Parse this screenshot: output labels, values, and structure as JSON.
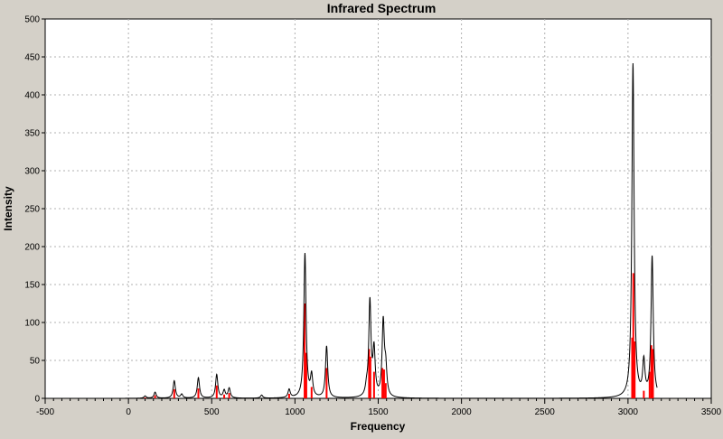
{
  "chart_data": {
    "type": "line",
    "title": "Infrared Spectrum",
    "xlabel": "Frequency",
    "ylabel": "Intensity",
    "xlim": [
      -500,
      3500
    ],
    "ylim": [
      0,
      500
    ],
    "x_ticks": [
      -500,
      0,
      500,
      1000,
      1500,
      2000,
      2500,
      3000,
      3500
    ],
    "y_ticks": [
      0,
      50,
      100,
      150,
      200,
      250,
      300,
      350,
      400,
      450,
      500
    ],
    "grid": true,
    "colors": {
      "background": "#ffffff",
      "frame": "#d4d0c8",
      "spectrum": "#000000",
      "stick": "#ff0000",
      "grid": "#b0b0b0"
    },
    "series": [
      {
        "type": "line",
        "peaks": [
          {
            "x": 100,
            "y": 3
          },
          {
            "x": 160,
            "y": 8
          },
          {
            "x": 275,
            "y": 23
          },
          {
            "x": 320,
            "y": 5
          },
          {
            "x": 420,
            "y": 27
          },
          {
            "x": 530,
            "y": 31
          },
          {
            "x": 575,
            "y": 10
          },
          {
            "x": 605,
            "y": 13
          },
          {
            "x": 800,
            "y": 4
          },
          {
            "x": 965,
            "y": 11
          },
          {
            "x": 1060,
            "y": 190
          },
          {
            "x": 1100,
            "y": 28
          },
          {
            "x": 1190,
            "y": 68
          },
          {
            "x": 1430,
            "y": 10
          },
          {
            "x": 1450,
            "y": 125
          },
          {
            "x": 1475,
            "y": 60
          },
          {
            "x": 1530,
            "y": 98
          },
          {
            "x": 1545,
            "y": 35
          },
          {
            "x": 3030,
            "y": 440
          },
          {
            "x": 3095,
            "y": 45
          },
          {
            "x": 3145,
            "y": 185
          }
        ]
      },
      {
        "type": "stick",
        "sticks": [
          {
            "x": 100,
            "y": 1
          },
          {
            "x": 160,
            "y": 4
          },
          {
            "x": 275,
            "y": 12
          },
          {
            "x": 420,
            "y": 13
          },
          {
            "x": 530,
            "y": 17
          },
          {
            "x": 575,
            "y": 5
          },
          {
            "x": 605,
            "y": 7
          },
          {
            "x": 965,
            "y": 6
          },
          {
            "x": 1058,
            "y": 125
          },
          {
            "x": 1068,
            "y": 60
          },
          {
            "x": 1100,
            "y": 15
          },
          {
            "x": 1190,
            "y": 40
          },
          {
            "x": 1445,
            "y": 65
          },
          {
            "x": 1453,
            "y": 55
          },
          {
            "x": 1475,
            "y": 35
          },
          {
            "x": 1525,
            "y": 40
          },
          {
            "x": 1535,
            "y": 38
          },
          {
            "x": 1545,
            "y": 20
          },
          {
            "x": 3025,
            "y": 80
          },
          {
            "x": 3032,
            "y": 165
          },
          {
            "x": 3040,
            "y": 75
          },
          {
            "x": 3095,
            "y": 10
          },
          {
            "x": 3130,
            "y": 35
          },
          {
            "x": 3140,
            "y": 70
          },
          {
            "x": 3150,
            "y": 65
          }
        ]
      }
    ]
  }
}
